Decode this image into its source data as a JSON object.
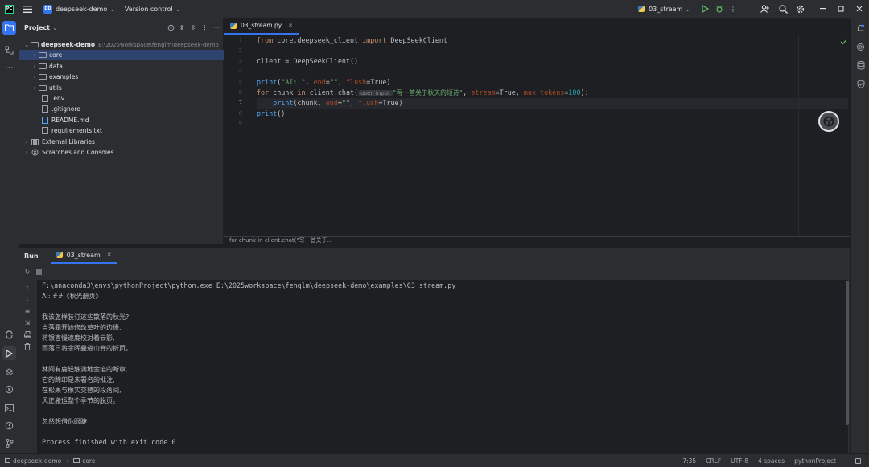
{
  "titlebar": {
    "project_badge": "DD",
    "project_name": "deepseek-demo",
    "version_control": "Version control",
    "run_config": "03_stream"
  },
  "project_panel": {
    "title": "Project",
    "root_name": "deepseek-demo",
    "root_path": "E:\\2025workspace\\fenglm\\deepseek-demo",
    "items": [
      {
        "label": "core",
        "kind": "folder"
      },
      {
        "label": "data",
        "kind": "folder"
      },
      {
        "label": "examples",
        "kind": "folder"
      },
      {
        "label": "utils",
        "kind": "folder"
      },
      {
        "label": ".env",
        "kind": "file"
      },
      {
        "label": ".gitignore",
        "kind": "file"
      },
      {
        "label": "README.md",
        "kind": "file"
      },
      {
        "label": "requirements.txt",
        "kind": "file"
      },
      {
        "label": "External Libraries",
        "kind": "lib"
      },
      {
        "label": "Scratches and Consoles",
        "kind": "scratch"
      }
    ]
  },
  "editor": {
    "tab_label": "03_stream.py",
    "line_numbers": [
      "1",
      "2",
      "3",
      "4",
      "5",
      "6",
      "7",
      "8",
      "9"
    ],
    "code": {
      "l1_kw1": "from",
      "l1_mod": " core.deepseek_client ",
      "l1_kw2": "import",
      "l1_name": " DeepSeekClient",
      "l3": "client = DeepSeekClient()",
      "l5_fn": "print",
      "l5_a": "(",
      "l5_s1": "\"AI: \"",
      "l5_b": ", ",
      "l5_p1": "end",
      "l5_c": "=",
      "l5_s2": "\"\"",
      "l5_d": ", ",
      "l5_p2": "flush",
      "l5_e": "=True)",
      "l6_kw1": "for",
      "l6_a": " chunk ",
      "l6_kw2": "in",
      "l6_b": " client.chat(",
      "l6_hint": "user_input",
      "l6_s1": "\"写一首关于秋天的短诗\"",
      "l6_c": ", ",
      "l6_p1": "stream",
      "l6_d": "=True, ",
      "l6_p2": "max_tokens",
      "l6_e": "=",
      "l6_num": "100",
      "l6_f": "):",
      "l7_fn": "print",
      "l7_a": "(chunk, ",
      "l7_p1": "end",
      "l7_b": "=",
      "l7_s1": "\"\"",
      "l7_c": ", ",
      "l7_p2": "flush",
      "l7_d": "=True)",
      "l8_fn": "print",
      "l8_a": "()"
    },
    "breadcrumb": "for chunk in client.chat(\"写一首关于..."
  },
  "run_panel": {
    "title": "Run",
    "tab_label": "03_stream",
    "console_lines": [
      "F:\\anaconda3\\envs\\pythonProject\\python.exe E:\\2025workspace\\fenglm\\deepseek-demo\\examples\\03_stream.py",
      "AI: ##《秋光册页》",
      "",
      "我该怎样装订这些散落的秋光?",
      "当落霜开始修改草叶的边缘,",
      "将银杏慢速度校对着云影,",
      "而落日将余晖叠进山脊的折页。",
      "",
      "林间有鹿轻触满地金箔的断章,",
      "它的蹄印是未署名的批注,",
      "在松果与橡实交替的段落间,",
      "风正搬运整个季节的脱页。",
      "",
      "忽然想借你眼睫",
      "",
      "Process finished with exit code 0"
    ]
  },
  "statusbar": {
    "project": "deepseek-demo",
    "folder": "core",
    "position": "7:35",
    "line_sep": "CRLF",
    "encoding": "UTF-8",
    "indent": "4 spaces",
    "interpreter": "pythonProject"
  },
  "colors": {
    "accent": "#3574f0",
    "selection": "#2e436e",
    "keyword": "#cf8e6d",
    "string": "#6aab73",
    "function": "#56a8f5",
    "param": "#aa4926"
  }
}
